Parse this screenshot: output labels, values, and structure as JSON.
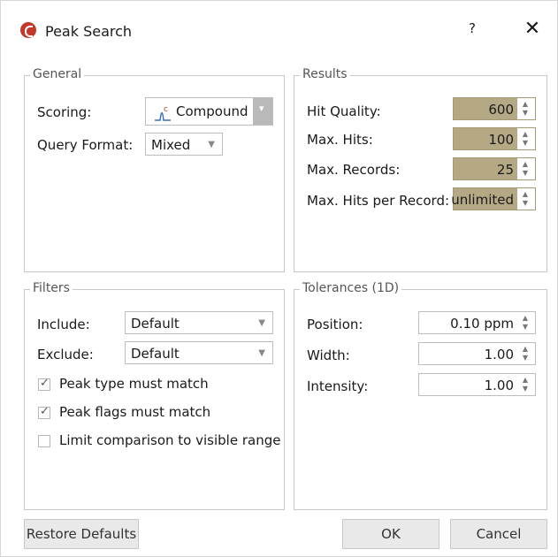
{
  "window": {
    "title": "Peak Search",
    "help_glyph": "?",
    "close_glyph": "✕"
  },
  "general": {
    "title": "General",
    "scoring_label": "Scoring:",
    "scoring_value": "Compound",
    "scoring_icon": "compound-peak-icon",
    "query_format_label": "Query Format:",
    "query_format_value": "Mixed"
  },
  "results": {
    "title": "Results",
    "hit_quality_label": "Hit Quality:",
    "hit_quality_value": "600",
    "max_hits_label": "Max. Hits:",
    "max_hits_value": "100",
    "max_records_label": "Max. Records:",
    "max_records_value": "25",
    "max_hits_per_record_label": "Max. Hits per Record:",
    "max_hits_per_record_value": "unlimited"
  },
  "filters": {
    "title": "Filters",
    "include_label": "Include:",
    "include_value": "Default",
    "exclude_label": "Exclude:",
    "exclude_value": "Default",
    "peak_type_label": "Peak type must match",
    "peak_type_checked": true,
    "peak_flags_label": "Peak flags must match",
    "peak_flags_checked": true,
    "limit_label": "Limit comparison to visible range",
    "limit_checked": false
  },
  "tolerances": {
    "title": "Tolerances (1D)",
    "position_label": "Position:",
    "position_value": "0.10 ppm",
    "width_label": "Width:",
    "width_value": "1.00",
    "intensity_label": "Intensity:",
    "intensity_value": "1.00"
  },
  "buttons": {
    "restore": "Restore Defaults",
    "ok": "OK",
    "cancel": "Cancel"
  },
  "colors": {
    "highlight_field": "#b5a985",
    "icon_red": "#c0392b"
  }
}
